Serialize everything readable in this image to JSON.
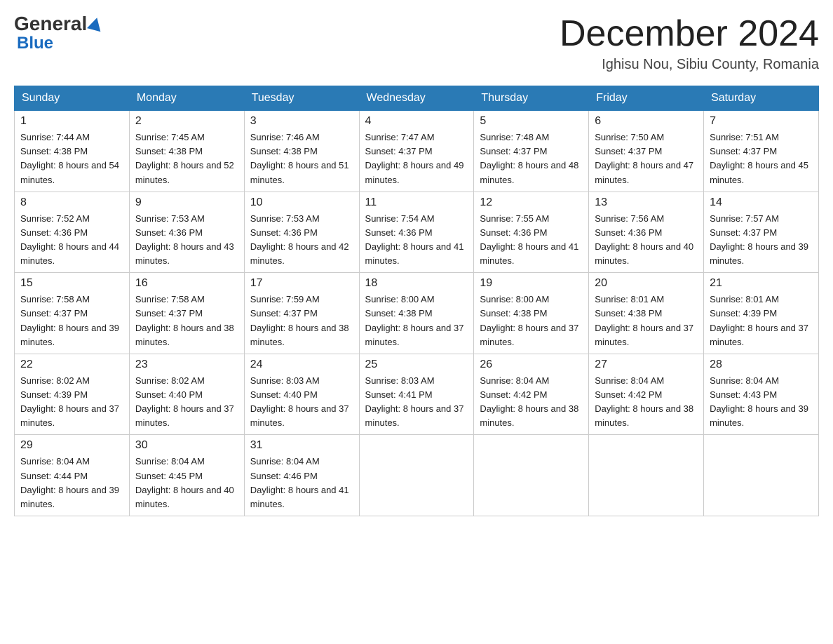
{
  "header": {
    "logo_general": "General",
    "logo_blue": "Blue",
    "month_title": "December 2024",
    "location": "Ighisu Nou, Sibiu County, Romania"
  },
  "days_of_week": [
    "Sunday",
    "Monday",
    "Tuesday",
    "Wednesday",
    "Thursday",
    "Friday",
    "Saturday"
  ],
  "weeks": [
    [
      {
        "day": "1",
        "sunrise": "7:44 AM",
        "sunset": "4:38 PM",
        "daylight": "8 hours and 54 minutes."
      },
      {
        "day": "2",
        "sunrise": "7:45 AM",
        "sunset": "4:38 PM",
        "daylight": "8 hours and 52 minutes."
      },
      {
        "day": "3",
        "sunrise": "7:46 AM",
        "sunset": "4:38 PM",
        "daylight": "8 hours and 51 minutes."
      },
      {
        "day": "4",
        "sunrise": "7:47 AM",
        "sunset": "4:37 PM",
        "daylight": "8 hours and 49 minutes."
      },
      {
        "day": "5",
        "sunrise": "7:48 AM",
        "sunset": "4:37 PM",
        "daylight": "8 hours and 48 minutes."
      },
      {
        "day": "6",
        "sunrise": "7:50 AM",
        "sunset": "4:37 PM",
        "daylight": "8 hours and 47 minutes."
      },
      {
        "day": "7",
        "sunrise": "7:51 AM",
        "sunset": "4:37 PM",
        "daylight": "8 hours and 45 minutes."
      }
    ],
    [
      {
        "day": "8",
        "sunrise": "7:52 AM",
        "sunset": "4:36 PM",
        "daylight": "8 hours and 44 minutes."
      },
      {
        "day": "9",
        "sunrise": "7:53 AM",
        "sunset": "4:36 PM",
        "daylight": "8 hours and 43 minutes."
      },
      {
        "day": "10",
        "sunrise": "7:53 AM",
        "sunset": "4:36 PM",
        "daylight": "8 hours and 42 minutes."
      },
      {
        "day": "11",
        "sunrise": "7:54 AM",
        "sunset": "4:36 PM",
        "daylight": "8 hours and 41 minutes."
      },
      {
        "day": "12",
        "sunrise": "7:55 AM",
        "sunset": "4:36 PM",
        "daylight": "8 hours and 41 minutes."
      },
      {
        "day": "13",
        "sunrise": "7:56 AM",
        "sunset": "4:36 PM",
        "daylight": "8 hours and 40 minutes."
      },
      {
        "day": "14",
        "sunrise": "7:57 AM",
        "sunset": "4:37 PM",
        "daylight": "8 hours and 39 minutes."
      }
    ],
    [
      {
        "day": "15",
        "sunrise": "7:58 AM",
        "sunset": "4:37 PM",
        "daylight": "8 hours and 39 minutes."
      },
      {
        "day": "16",
        "sunrise": "7:58 AM",
        "sunset": "4:37 PM",
        "daylight": "8 hours and 38 minutes."
      },
      {
        "day": "17",
        "sunrise": "7:59 AM",
        "sunset": "4:37 PM",
        "daylight": "8 hours and 38 minutes."
      },
      {
        "day": "18",
        "sunrise": "8:00 AM",
        "sunset": "4:38 PM",
        "daylight": "8 hours and 37 minutes."
      },
      {
        "day": "19",
        "sunrise": "8:00 AM",
        "sunset": "4:38 PM",
        "daylight": "8 hours and 37 minutes."
      },
      {
        "day": "20",
        "sunrise": "8:01 AM",
        "sunset": "4:38 PM",
        "daylight": "8 hours and 37 minutes."
      },
      {
        "day": "21",
        "sunrise": "8:01 AM",
        "sunset": "4:39 PM",
        "daylight": "8 hours and 37 minutes."
      }
    ],
    [
      {
        "day": "22",
        "sunrise": "8:02 AM",
        "sunset": "4:39 PM",
        "daylight": "8 hours and 37 minutes."
      },
      {
        "day": "23",
        "sunrise": "8:02 AM",
        "sunset": "4:40 PM",
        "daylight": "8 hours and 37 minutes."
      },
      {
        "day": "24",
        "sunrise": "8:03 AM",
        "sunset": "4:40 PM",
        "daylight": "8 hours and 37 minutes."
      },
      {
        "day": "25",
        "sunrise": "8:03 AM",
        "sunset": "4:41 PM",
        "daylight": "8 hours and 37 minutes."
      },
      {
        "day": "26",
        "sunrise": "8:04 AM",
        "sunset": "4:42 PM",
        "daylight": "8 hours and 38 minutes."
      },
      {
        "day": "27",
        "sunrise": "8:04 AM",
        "sunset": "4:42 PM",
        "daylight": "8 hours and 38 minutes."
      },
      {
        "day": "28",
        "sunrise": "8:04 AM",
        "sunset": "4:43 PM",
        "daylight": "8 hours and 39 minutes."
      }
    ],
    [
      {
        "day": "29",
        "sunrise": "8:04 AM",
        "sunset": "4:44 PM",
        "daylight": "8 hours and 39 minutes."
      },
      {
        "day": "30",
        "sunrise": "8:04 AM",
        "sunset": "4:45 PM",
        "daylight": "8 hours and 40 minutes."
      },
      {
        "day": "31",
        "sunrise": "8:04 AM",
        "sunset": "4:46 PM",
        "daylight": "8 hours and 41 minutes."
      },
      null,
      null,
      null,
      null
    ]
  ],
  "labels": {
    "sunrise_prefix": "Sunrise: ",
    "sunset_prefix": "Sunset: ",
    "daylight_prefix": "Daylight: "
  }
}
